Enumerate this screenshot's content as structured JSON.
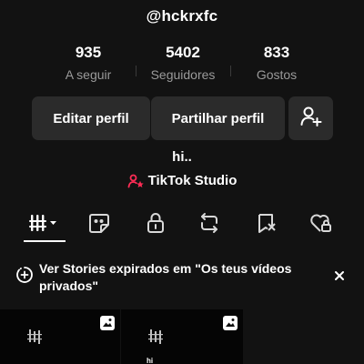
{
  "profile": {
    "username": "@hckrxfc",
    "bio": "hi..",
    "studio_label": "TikTok Studio"
  },
  "stats": {
    "following": {
      "value": "935",
      "label": "A seguir"
    },
    "followers": {
      "value": "5402",
      "label": "Seguidores"
    },
    "likes": {
      "value": "833",
      "label": "Gostos"
    }
  },
  "actions": {
    "edit_label": "Editar perfil",
    "share_label": "Partilhar perfil",
    "add_friend_icon": "person-add-icon"
  },
  "tabs": [
    {
      "icon": "videos-grid-icon",
      "active": true
    },
    {
      "icon": "sticker-icon",
      "active": false
    },
    {
      "icon": "lock-icon",
      "active": false
    },
    {
      "icon": "repost-icon",
      "active": false
    },
    {
      "icon": "bookmark-icon",
      "active": false
    },
    {
      "icon": "liked-heart-icon",
      "active": false
    }
  ],
  "banner": {
    "text": "Ver Stories expirados em \"Os teus vídeos privados\"",
    "icon": "story-plus-icon",
    "close_icon": "close-icon"
  },
  "grid": {
    "items": [
      {
        "caption": ""
      },
      {
        "caption": "hi"
      },
      {
        "caption": ""
      }
    ]
  },
  "colors": {
    "background": "#121212",
    "button_bg": "#2b2b2b",
    "muted_text": "#9a9a9a",
    "studio_accent": "#fe2c55"
  }
}
